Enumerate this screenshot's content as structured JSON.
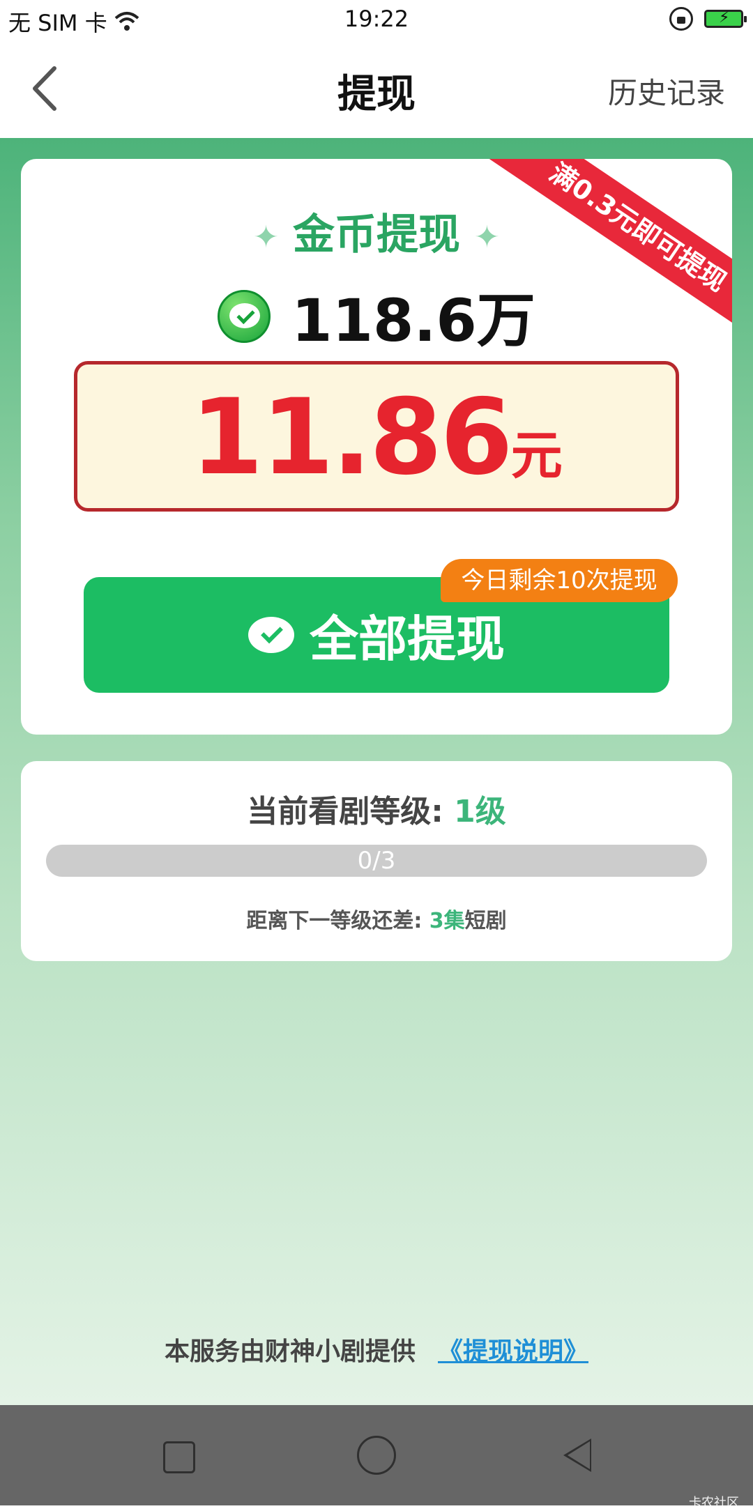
{
  "status_bar": {
    "carrier": "无 SIM 卡",
    "time": "19:22"
  },
  "header": {
    "title": "提现",
    "history": "历史记录"
  },
  "withdraw_card": {
    "ribbon": "满0.3元即可提现",
    "title": "金币提现",
    "coins": "118.6万",
    "amount": "11.86",
    "amount_unit": "元",
    "button_label": "全部提现",
    "remaining_badge": "今日剩余10次提现"
  },
  "level_card": {
    "title_prefix": "当前看剧等级: ",
    "level": "1级",
    "progress_text": "0/3",
    "progress_fraction": 0,
    "next_prefix": "距离下一等级还差: ",
    "next_count": "3集",
    "next_suffix": "短剧"
  },
  "footer": {
    "service_text": "本服务由财神小剧提供",
    "link_text": "《提现说明》"
  },
  "watermark": "卡农社区",
  "colors": {
    "primary_green": "#1cbd63",
    "accent_red": "#e6242e",
    "badge_orange": "#f38013"
  }
}
